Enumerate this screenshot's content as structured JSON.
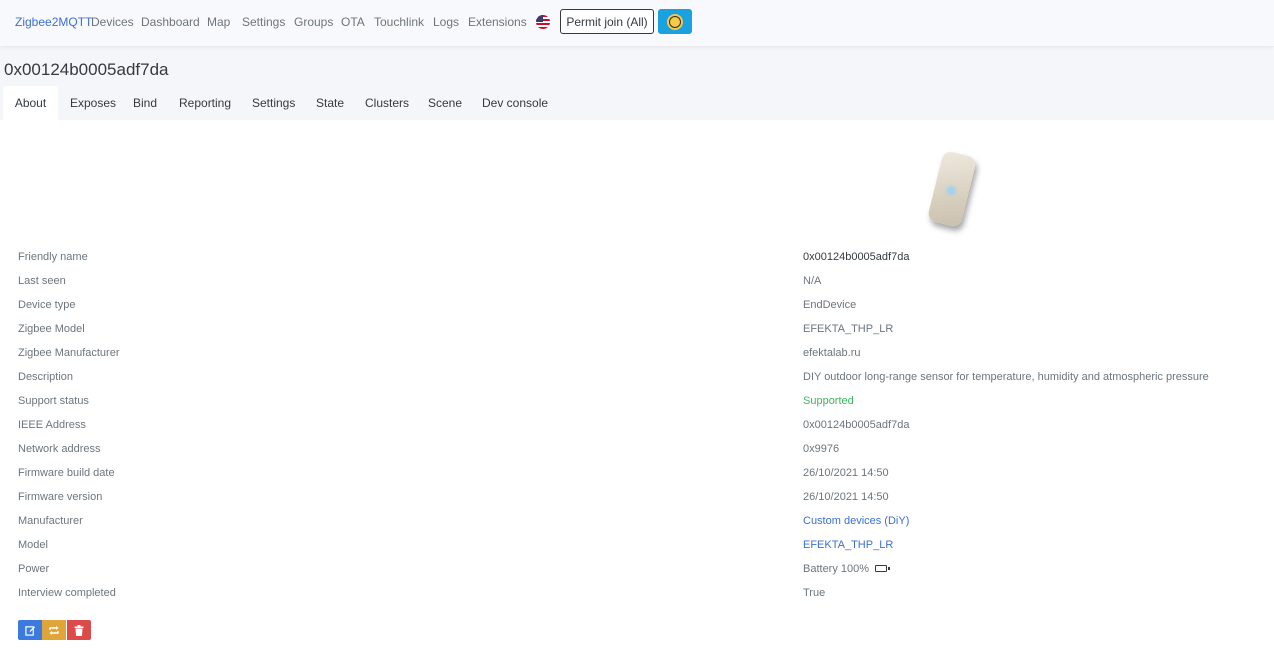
{
  "nav": {
    "brand": "Zigbee2MQTT",
    "items": [
      "Devices",
      "Dashboard",
      "Map",
      "Settings",
      "Groups",
      "OTA",
      "Touchlink",
      "Logs",
      "Extensions"
    ],
    "language_icon": "us-flag-icon",
    "permit_join_label": "Permit join (All)",
    "theme_icon": "sun-icon"
  },
  "page": {
    "title": "0x00124b0005adf7da"
  },
  "tabs": [
    "About",
    "Exposes",
    "Bind",
    "Reporting",
    "Settings",
    "State",
    "Clusters",
    "Scene",
    "Dev console"
  ],
  "active_tab": "About",
  "device": {
    "rows": [
      {
        "label": "Friendly name",
        "value": "0x00124b0005adf7da"
      },
      {
        "label": "Last seen",
        "value": "N/A"
      },
      {
        "label": "Device type",
        "value": "EndDevice"
      },
      {
        "label": "Zigbee Model",
        "value": "EFEKTA_THP_LR"
      },
      {
        "label": "Zigbee Manufacturer",
        "value": "efektalab.ru"
      },
      {
        "label": "Description",
        "value": "DIY outdoor long-range sensor for temperature, humidity and atmospheric pressure"
      },
      {
        "label": "Support status",
        "value": "Supported"
      },
      {
        "label": "IEEE Address",
        "value": "0x00124b0005adf7da"
      },
      {
        "label": "Network address",
        "value": "0x9976"
      },
      {
        "label": "Firmware build date",
        "value": "26/10/2021 14:50"
      },
      {
        "label": "Firmware version",
        "value": "26/10/2021 14:50"
      },
      {
        "label": "Manufacturer",
        "value": "Custom devices (DiY)"
      },
      {
        "label": "Model",
        "value": "EFEKTA_THP_LR"
      },
      {
        "label": "Power",
        "value": "Battery 100%"
      },
      {
        "label": "Interview completed",
        "value": "True"
      }
    ],
    "power_icon": "battery-full-icon"
  },
  "actions": {
    "edit_icon": "edit-icon",
    "interview_icon": "reconfigure-icon",
    "remove_icon": "trash-icon"
  },
  "colors": {
    "brand": "#3c6fd1",
    "supported": "#3fb65f",
    "theme_button": "#1aa1e0",
    "edit": "#3c7ae0",
    "interview": "#e0a53a",
    "remove": "#dc4a4a"
  }
}
